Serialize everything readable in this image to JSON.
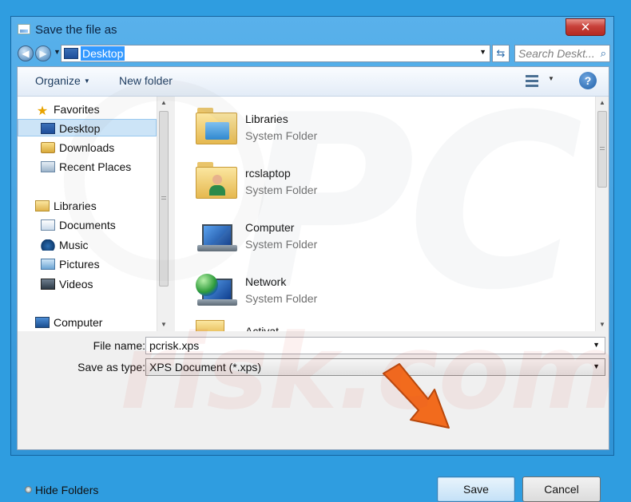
{
  "window": {
    "title": "Save the file as",
    "close_label": "✕"
  },
  "address": {
    "location": "Desktop",
    "search_placeholder": "Search Deskt...",
    "refresh_glyph": "⇆",
    "search_glyph": "⌕"
  },
  "toolbar": {
    "organize_label": "Organize",
    "new_folder_label": "New folder",
    "help_glyph": "?"
  },
  "nav": {
    "favorites_header": "Favorites",
    "favorites": [
      "Desktop",
      "Downloads",
      "Recent Places"
    ],
    "libraries_header": "Libraries",
    "libraries": [
      "Documents",
      "Music",
      "Pictures",
      "Videos"
    ],
    "computer_label": "Computer",
    "selected": "Desktop"
  },
  "files": [
    {
      "name": "Libraries",
      "type": "System Folder",
      "icon": "libraries-folder-icon"
    },
    {
      "name": "rcslaptop",
      "type": "System Folder",
      "icon": "user-folder-icon"
    },
    {
      "name": "Computer",
      "type": "System Folder",
      "icon": "computer-icon"
    },
    {
      "name": "Network",
      "type": "System Folder",
      "icon": "network-icon"
    }
  ],
  "partial_item": "Activat...",
  "form": {
    "filename_label": "File name:",
    "filename_value": "pcrisk.xps",
    "type_label": "Save as type:",
    "type_value": "XPS Document (*.xps)"
  },
  "hide_folders_label": "Hide Folders",
  "buttons": {
    "save": "Save",
    "cancel": "Cancel"
  },
  "watermark": {
    "text1": "PC",
    "text2": "risk.com"
  },
  "colors": {
    "accent": "#2f9de0",
    "selection": "#3399ff",
    "arrow": "#f26b1d"
  }
}
